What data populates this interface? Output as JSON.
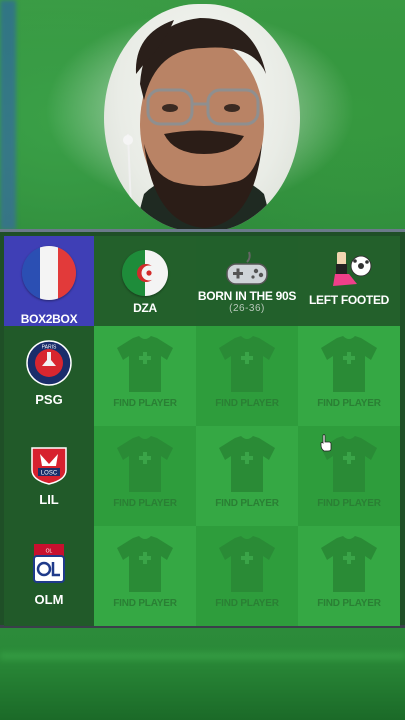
{
  "game": {
    "badge_label": "BOX2BOX"
  },
  "columns": [
    {
      "label": "DZA",
      "sub": "",
      "icon": "algeria-flag-icon"
    },
    {
      "label": "BORN IN THE 90S",
      "sub": "(26-36)",
      "icon": "gamepad-icon"
    },
    {
      "label": "LEFT FOOTED",
      "sub": "",
      "icon": "football-boot-icon"
    }
  ],
  "rows": [
    {
      "label": "PSG",
      "icon": "psg-logo-icon"
    },
    {
      "label": "LIL",
      "icon": "losc-logo-icon"
    },
    {
      "label": "OLM",
      "icon": "ol-logo-icon"
    }
  ],
  "cells": {
    "find_label": "FIND PLAYER"
  },
  "colors": {
    "badge_blue": "#3f3fb6",
    "cell_green": "#35a844",
    "board_dark": "#1f4f27"
  }
}
